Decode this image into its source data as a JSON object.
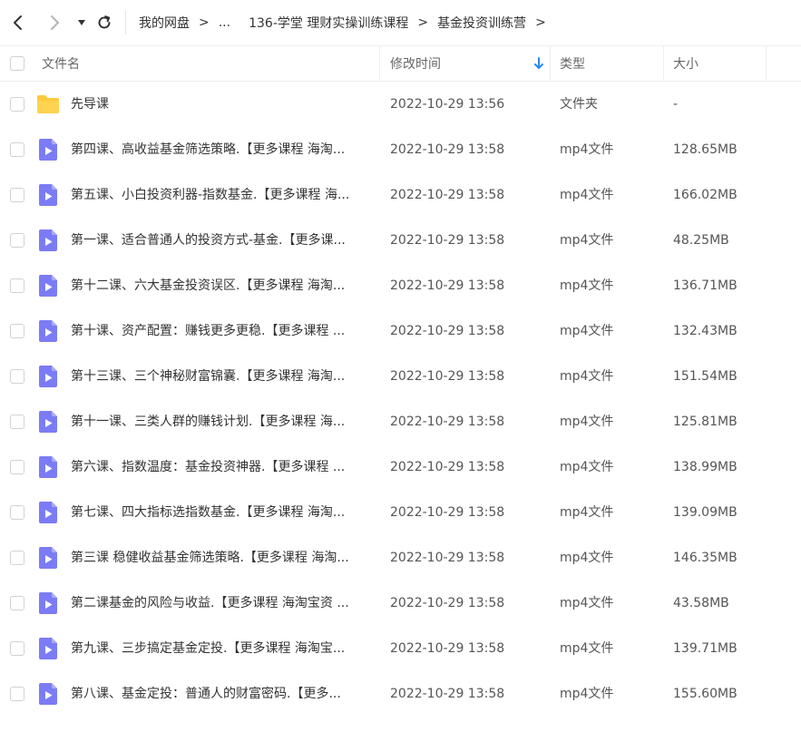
{
  "nav": {
    "back_icon": "chevron-left-icon",
    "forward_icon": "chevron-right-icon",
    "dropdown_icon": "caret-down-icon",
    "refresh_icon": "refresh-icon"
  },
  "breadcrumb": {
    "root": "我的网盘",
    "ellipsis": "...",
    "level1": "136-学堂 理财实操训练课程",
    "current": "基金投资训练营",
    "separator": ">"
  },
  "header": {
    "name": "文件名",
    "modified": "修改时间",
    "type": "类型",
    "size": "大小",
    "sort_icon": "sort-down-arrow-icon"
  },
  "colors": {
    "folder": "#FFC93C",
    "video": "#7B7CF5",
    "sort_arrow": "#2A8BF2"
  },
  "files": [
    {
      "name": "先导课",
      "date": "2022-10-29 13:56",
      "type": "文件夹",
      "size": "-",
      "icon": "folder-icon"
    },
    {
      "name": "第四课、高收益基金筛选策略.【更多课程 海淘...",
      "date": "2022-10-29 13:58",
      "type": "mp4文件",
      "size": "128.65MB",
      "icon": "video-file-icon"
    },
    {
      "name": "第五课、小白投资利器-指数基金.【更多课程 海...",
      "date": "2022-10-29 13:58",
      "type": "mp4文件",
      "size": "166.02MB",
      "icon": "video-file-icon"
    },
    {
      "name": "第一课、适合普通人的投资方式-基金.【更多课...",
      "date": "2022-10-29 13:58",
      "type": "mp4文件",
      "size": "48.25MB",
      "icon": "video-file-icon"
    },
    {
      "name": "第十二课、六大基金投资误区.【更多课程 海淘...",
      "date": "2022-10-29 13:58",
      "type": "mp4文件",
      "size": "136.71MB",
      "icon": "video-file-icon"
    },
    {
      "name": "第十课、资产配置：赚钱更多更稳.【更多课程 ...",
      "date": "2022-10-29 13:58",
      "type": "mp4文件",
      "size": "132.43MB",
      "icon": "video-file-icon"
    },
    {
      "name": "第十三课、三个神秘财富锦囊.【更多课程 海淘...",
      "date": "2022-10-29 13:58",
      "type": "mp4文件",
      "size": "151.54MB",
      "icon": "video-file-icon"
    },
    {
      "name": "第十一课、三类人群的赚钱计划.【更多课程 海...",
      "date": "2022-10-29 13:58",
      "type": "mp4文件",
      "size": "125.81MB",
      "icon": "video-file-icon"
    },
    {
      "name": "第六课、指数温度：基金投资神器.【更多课程 ...",
      "date": "2022-10-29 13:58",
      "type": "mp4文件",
      "size": "138.99MB",
      "icon": "video-file-icon"
    },
    {
      "name": "第七课、四大指标选指数基金.【更多课程 海淘...",
      "date": "2022-10-29 13:58",
      "type": "mp4文件",
      "size": "139.09MB",
      "icon": "video-file-icon"
    },
    {
      "name": "第三课 稳健收益基金筛选策略.【更多课程 海淘...",
      "date": "2022-10-29 13:58",
      "type": "mp4文件",
      "size": "146.35MB",
      "icon": "video-file-icon"
    },
    {
      "name": "第二课基金的风险与收益.【更多课程 海淘宝资 ...",
      "date": "2022-10-29 13:58",
      "type": "mp4文件",
      "size": "43.58MB",
      "icon": "video-file-icon"
    },
    {
      "name": "第九课、三步搞定基金定投.【更多课程 海淘宝...",
      "date": "2022-10-29 13:58",
      "type": "mp4文件",
      "size": "139.71MB",
      "icon": "video-file-icon"
    },
    {
      "name": "第八课、基金定投：普通人的财富密码.【更多...",
      "date": "2022-10-29 13:58",
      "type": "mp4文件",
      "size": "155.60MB",
      "icon": "video-file-icon"
    }
  ]
}
